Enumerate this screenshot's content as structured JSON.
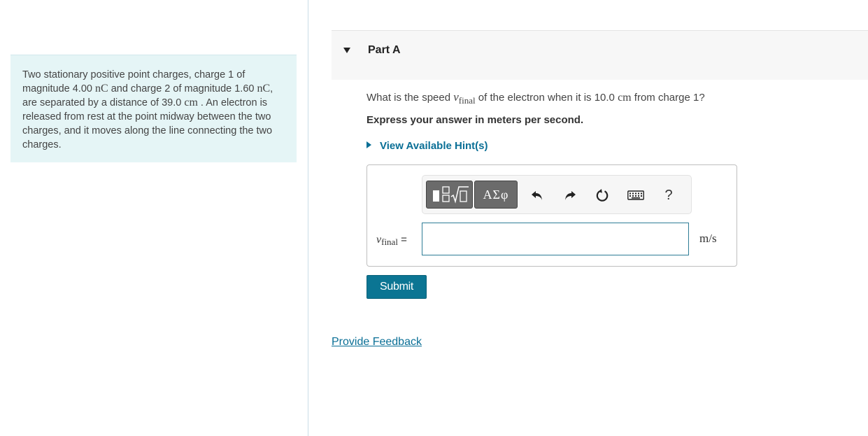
{
  "problem": {
    "text_1": "Two stationary positive point charges, charge 1 of magnitude 4.00 ",
    "unit_nc": "nC",
    "text_2": " and charge 2 of magnitude 1.60 ",
    "text_3": ", are separated by a distance of 39.0 ",
    "unit_cm": "cm",
    "text_4": " . An electron is released from rest at the point midway between the two charges, and it moves along the line connecting the two charges."
  },
  "part": {
    "title": "Part A"
  },
  "question": {
    "text_before": "What is the speed ",
    "var_symbol": "v",
    "var_subscript": "final",
    "text_after": " of the electron when it is 10.0 ",
    "unit_cm": "cm",
    "text_end": " from charge 1?"
  },
  "instruction": "Express your answer in meters per second.",
  "hint_label": "View Available Hint(s)",
  "toolbar": {
    "greek_label": "ΑΣφ",
    "help_label": "?"
  },
  "answer": {
    "var_symbol": "v",
    "var_subscript": "final",
    "equals": "=",
    "value": "",
    "unit": "m/s"
  },
  "submit_label": "Submit",
  "feedback_label": "Provide Feedback"
}
